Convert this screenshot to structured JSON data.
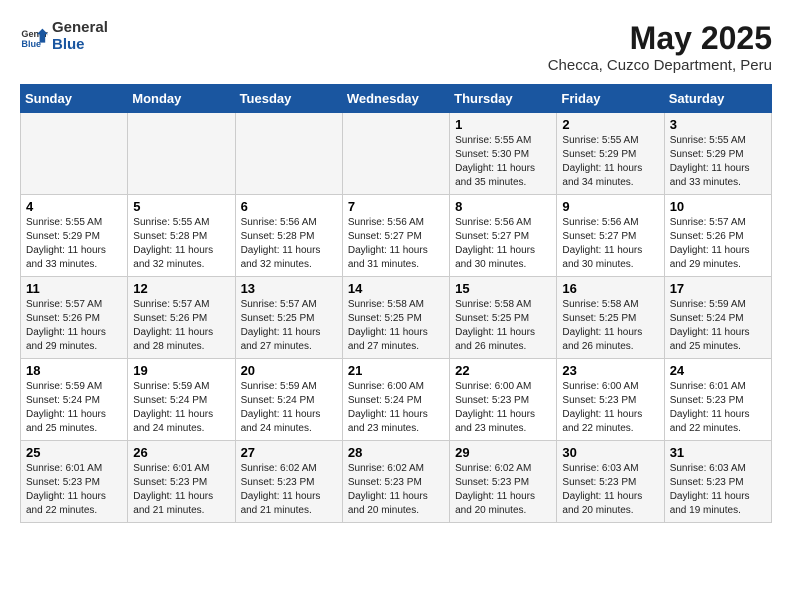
{
  "logo": {
    "general": "General",
    "blue": "Blue"
  },
  "title": "May 2025",
  "subtitle": "Checca, Cuzco Department, Peru",
  "weekdays": [
    "Sunday",
    "Monday",
    "Tuesday",
    "Wednesday",
    "Thursday",
    "Friday",
    "Saturday"
  ],
  "weeks": [
    [
      {
        "day": "",
        "info": ""
      },
      {
        "day": "",
        "info": ""
      },
      {
        "day": "",
        "info": ""
      },
      {
        "day": "",
        "info": ""
      },
      {
        "day": "1",
        "info": "Sunrise: 5:55 AM\nSunset: 5:30 PM\nDaylight: 11 hours and 35 minutes."
      },
      {
        "day": "2",
        "info": "Sunrise: 5:55 AM\nSunset: 5:29 PM\nDaylight: 11 hours and 34 minutes."
      },
      {
        "day": "3",
        "info": "Sunrise: 5:55 AM\nSunset: 5:29 PM\nDaylight: 11 hours and 33 minutes."
      }
    ],
    [
      {
        "day": "4",
        "info": "Sunrise: 5:55 AM\nSunset: 5:29 PM\nDaylight: 11 hours and 33 minutes."
      },
      {
        "day": "5",
        "info": "Sunrise: 5:55 AM\nSunset: 5:28 PM\nDaylight: 11 hours and 32 minutes."
      },
      {
        "day": "6",
        "info": "Sunrise: 5:56 AM\nSunset: 5:28 PM\nDaylight: 11 hours and 32 minutes."
      },
      {
        "day": "7",
        "info": "Sunrise: 5:56 AM\nSunset: 5:27 PM\nDaylight: 11 hours and 31 minutes."
      },
      {
        "day": "8",
        "info": "Sunrise: 5:56 AM\nSunset: 5:27 PM\nDaylight: 11 hours and 30 minutes."
      },
      {
        "day": "9",
        "info": "Sunrise: 5:56 AM\nSunset: 5:27 PM\nDaylight: 11 hours and 30 minutes."
      },
      {
        "day": "10",
        "info": "Sunrise: 5:57 AM\nSunset: 5:26 PM\nDaylight: 11 hours and 29 minutes."
      }
    ],
    [
      {
        "day": "11",
        "info": "Sunrise: 5:57 AM\nSunset: 5:26 PM\nDaylight: 11 hours and 29 minutes."
      },
      {
        "day": "12",
        "info": "Sunrise: 5:57 AM\nSunset: 5:26 PM\nDaylight: 11 hours and 28 minutes."
      },
      {
        "day": "13",
        "info": "Sunrise: 5:57 AM\nSunset: 5:25 PM\nDaylight: 11 hours and 27 minutes."
      },
      {
        "day": "14",
        "info": "Sunrise: 5:58 AM\nSunset: 5:25 PM\nDaylight: 11 hours and 27 minutes."
      },
      {
        "day": "15",
        "info": "Sunrise: 5:58 AM\nSunset: 5:25 PM\nDaylight: 11 hours and 26 minutes."
      },
      {
        "day": "16",
        "info": "Sunrise: 5:58 AM\nSunset: 5:25 PM\nDaylight: 11 hours and 26 minutes."
      },
      {
        "day": "17",
        "info": "Sunrise: 5:59 AM\nSunset: 5:24 PM\nDaylight: 11 hours and 25 minutes."
      }
    ],
    [
      {
        "day": "18",
        "info": "Sunrise: 5:59 AM\nSunset: 5:24 PM\nDaylight: 11 hours and 25 minutes."
      },
      {
        "day": "19",
        "info": "Sunrise: 5:59 AM\nSunset: 5:24 PM\nDaylight: 11 hours and 24 minutes."
      },
      {
        "day": "20",
        "info": "Sunrise: 5:59 AM\nSunset: 5:24 PM\nDaylight: 11 hours and 24 minutes."
      },
      {
        "day": "21",
        "info": "Sunrise: 6:00 AM\nSunset: 5:24 PM\nDaylight: 11 hours and 23 minutes."
      },
      {
        "day": "22",
        "info": "Sunrise: 6:00 AM\nSunset: 5:23 PM\nDaylight: 11 hours and 23 minutes."
      },
      {
        "day": "23",
        "info": "Sunrise: 6:00 AM\nSunset: 5:23 PM\nDaylight: 11 hours and 22 minutes."
      },
      {
        "day": "24",
        "info": "Sunrise: 6:01 AM\nSunset: 5:23 PM\nDaylight: 11 hours and 22 minutes."
      }
    ],
    [
      {
        "day": "25",
        "info": "Sunrise: 6:01 AM\nSunset: 5:23 PM\nDaylight: 11 hours and 22 minutes."
      },
      {
        "day": "26",
        "info": "Sunrise: 6:01 AM\nSunset: 5:23 PM\nDaylight: 11 hours and 21 minutes."
      },
      {
        "day": "27",
        "info": "Sunrise: 6:02 AM\nSunset: 5:23 PM\nDaylight: 11 hours and 21 minutes."
      },
      {
        "day": "28",
        "info": "Sunrise: 6:02 AM\nSunset: 5:23 PM\nDaylight: 11 hours and 20 minutes."
      },
      {
        "day": "29",
        "info": "Sunrise: 6:02 AM\nSunset: 5:23 PM\nDaylight: 11 hours and 20 minutes."
      },
      {
        "day": "30",
        "info": "Sunrise: 6:03 AM\nSunset: 5:23 PM\nDaylight: 11 hours and 20 minutes."
      },
      {
        "day": "31",
        "info": "Sunrise: 6:03 AM\nSunset: 5:23 PM\nDaylight: 11 hours and 19 minutes."
      }
    ]
  ]
}
